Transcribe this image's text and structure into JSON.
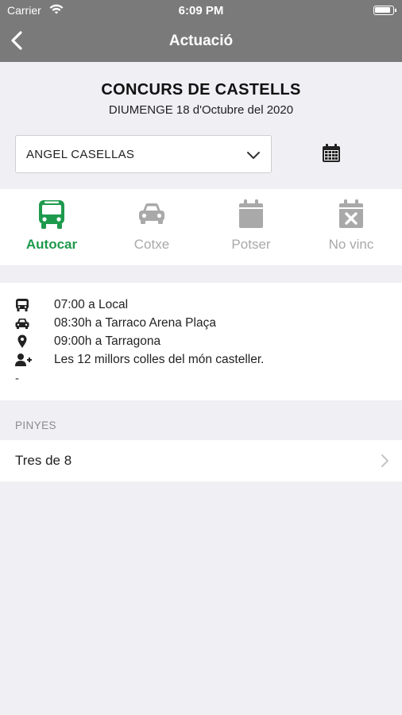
{
  "status": {
    "carrier": "Carrier",
    "time": "6:09 PM"
  },
  "nav": {
    "title": "Actuació"
  },
  "event": {
    "title": "CONCURS DE CASTELLS",
    "date": "DIUMENGE 18 d'Octubre del 2020"
  },
  "member_select": {
    "value": "ANGEL CASELLAS"
  },
  "attendance": {
    "selected": "Autocar",
    "options": [
      {
        "label": "Autocar",
        "icon": "bus-icon"
      },
      {
        "label": "Cotxe",
        "icon": "car-icon"
      },
      {
        "label": "Potser",
        "icon": "calendar-icon"
      },
      {
        "label": "No vinc",
        "icon": "calendar-x-icon"
      }
    ]
  },
  "details": [
    {
      "icon": "bus-icon",
      "text": "07:00 a Local"
    },
    {
      "icon": "car-icon",
      "text": "08:30h a Tarraco Arena Plaça"
    },
    {
      "icon": "map-marker-icon",
      "text": "09:00h a Tarragona"
    },
    {
      "icon": "user-plus-icon",
      "text": "Les 12 millors colles del món casteller."
    }
  ],
  "details_extra": "-",
  "pinyes": {
    "header": "PINYES",
    "items": [
      {
        "label": "Tres de 8"
      }
    ]
  },
  "colors": {
    "nav_bg": "#7a7a7a",
    "accent_green": "#1e9a4c",
    "inactive_gray": "#a9a9a9",
    "background": "#efeff4"
  }
}
